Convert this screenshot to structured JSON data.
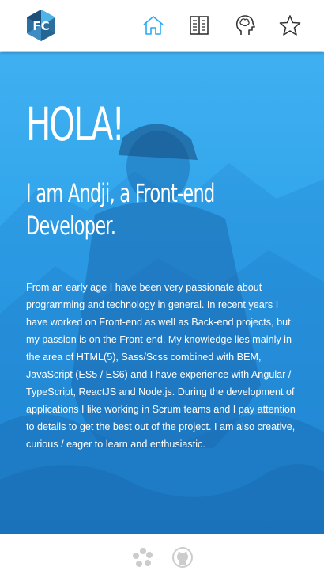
{
  "header": {
    "logo_text": "FC",
    "nav": [
      {
        "icon": "home-icon",
        "active": true
      },
      {
        "icon": "book-icon",
        "active": false
      },
      {
        "icon": "brain-head-icon",
        "active": false
      },
      {
        "icon": "star-icon",
        "active": false
      }
    ]
  },
  "hero": {
    "greeting": "HOLA!",
    "intro": "I am Andji, a Front-end Developer.",
    "bio": "From an early age I have been very passionate about programming and technology in general. In recent years I have worked on Front-end as well as Back-end projects, but my passion is on the Front-end. My knowledge lies mainly in the area of HTML(5), Sass/Scss combined with BEM, JavaScript (ES5 / ES6) and I have experience with Angular / TypeScript, ReactJS and Node.js. During the development of applications I like working in Scrum teams and I pay attention to details to get the best out of the project. I am also creative, curious / eager to learn and enthusiastic."
  },
  "footer": {
    "links": [
      {
        "icon": "codepen-cluster-icon"
      },
      {
        "icon": "github-icon"
      }
    ]
  },
  "colors": {
    "accent": "#29aaf4",
    "icon_inactive": "#333333",
    "footer_icon": "#cccccc",
    "hero_overlay": "#2ea3ea"
  }
}
